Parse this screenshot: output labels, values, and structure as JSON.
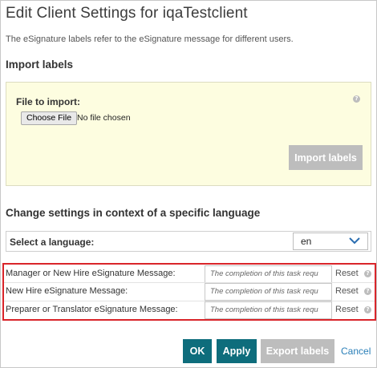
{
  "dialog": {
    "title": "Edit Client Settings for iqaTestclient",
    "description": "The eSignature labels refer to the eSignature message for different users."
  },
  "import_section": {
    "heading": "Import labels",
    "file_label": "File to import:",
    "choose_file_label": "Choose File",
    "no_file_text": "No file chosen",
    "help_glyph": "?",
    "import_button_label": "Import labels",
    "import_button_enabled": false
  },
  "language_section": {
    "heading": "Change settings in context of a specific language",
    "select_label": "Select a language:",
    "selected_language": "en"
  },
  "settings": {
    "rows": [
      {
        "label": "Manager or New Hire eSignature Message:",
        "value": "The completion of this task requ",
        "reset_label": "Reset"
      },
      {
        "label": "New Hire eSignature Message:",
        "value": "The completion of this task requ",
        "reset_label": "Reset"
      },
      {
        "label": "Preparer or Translator eSignature Message:",
        "value": "The completion of this task requ",
        "reset_label": "Reset"
      }
    ],
    "highlight_color": "#d9252a"
  },
  "footer": {
    "ok_label": "OK",
    "apply_label": "Apply",
    "export_label": "Export labels",
    "cancel_label": "Cancel"
  },
  "colors": {
    "primary_button": "#0e6d7c",
    "disabled_button": "#bdbdbd",
    "import_panel_bg": "#fdfde0",
    "link": "#2a7fb8"
  }
}
